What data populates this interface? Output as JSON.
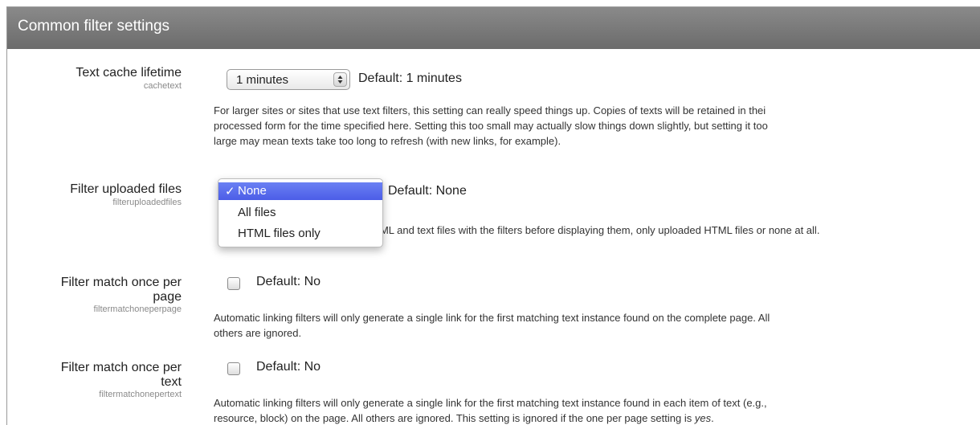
{
  "header": {
    "title": "Common filter settings"
  },
  "settings": {
    "cachetext": {
      "label": "Text cache lifetime",
      "name": "cachetext",
      "select_value": "1 minutes",
      "default": "Default: 1 minutes",
      "description": [
        "For larger sites or sites that use text filters, this setting can really speed things up. Copies of texts will be retained in thei",
        "processed form for the time specified here. Setting this too small may actually slow things down slightly, but setting it too",
        "large may mean texts take too long to refresh (with new links, for example)."
      ]
    },
    "filteruploadedfiles": {
      "label": "Filter uploaded files",
      "name": "filteruploadedfiles",
      "default": "Default: None",
      "options": [
        "None",
        "All files",
        "HTML files only"
      ],
      "selected_index": 0,
      "check_glyph": "✓",
      "description_visible": "TML and text files with the filters before displaying them, only uploaded HTML files or none at all."
    },
    "filtermatchoneperpage": {
      "label_line1": "Filter match once per",
      "label_line2": "page",
      "name": "filtermatchoneperpage",
      "checked": false,
      "default": "Default: No",
      "description": [
        "Automatic linking filters will only generate a single link for the first matching text instance found on the complete page. All",
        "others are ignored."
      ]
    },
    "filtermatchonepertext": {
      "label_line1": "Filter match once per",
      "label_line2": "text",
      "name": "filtermatchonepertext",
      "checked": false,
      "default": "Default: No",
      "description_line1": "Automatic linking filters will only generate a single link for the first matching text instance found in each item of text (e.g.,",
      "description_line2_pre": "resource, block) on the page. All others are ignored. This setting is ignored if the one per page setting is ",
      "description_line2_em": "yes",
      "description_line2_post": "."
    }
  },
  "colors": {
    "header_bg": "#7b7b7b",
    "menu_highlight": "#5a6cee",
    "sublabel": "#8a8a8a"
  },
  "icons": {
    "select_stepper": "up-down-arrows",
    "checkmark": "check-icon"
  }
}
